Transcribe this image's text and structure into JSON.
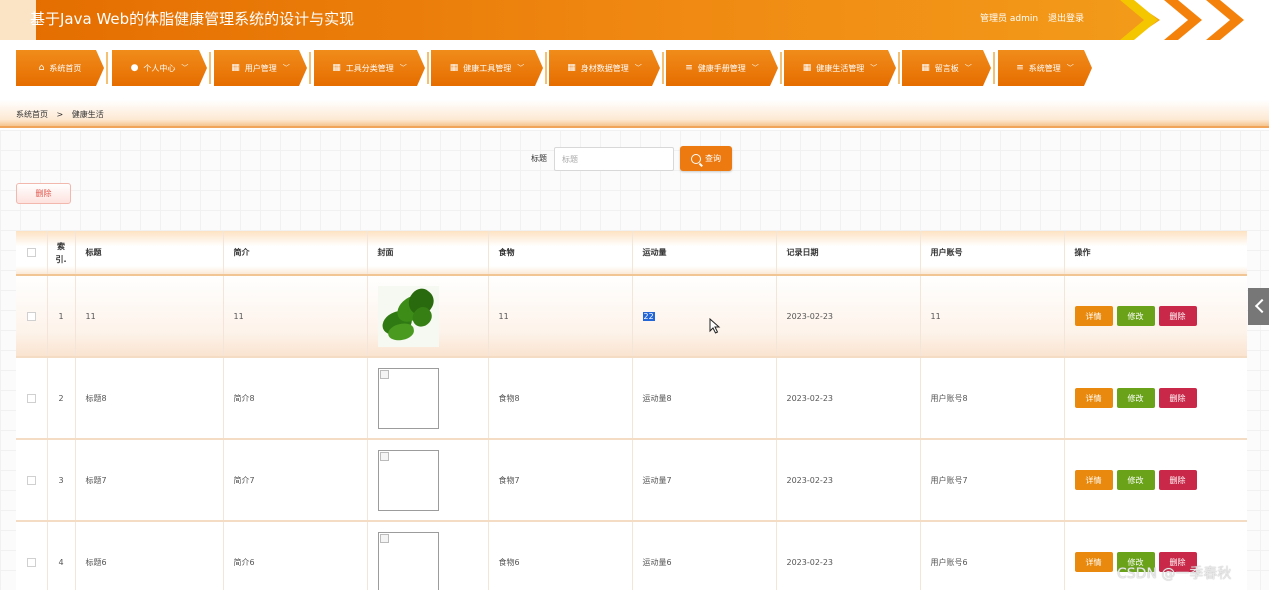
{
  "header": {
    "title": "基于Java Web的体脂健康管理系统的设计与实现",
    "user_label": "管理员 admin",
    "logout_label": "退出登录"
  },
  "nav": {
    "items": [
      {
        "label": "系统首页",
        "icon": "home-icon",
        "has_dropdown": false
      },
      {
        "label": "个人中心",
        "icon": "user-icon",
        "has_dropdown": true
      },
      {
        "label": "用户管理",
        "icon": "grid-icon",
        "has_dropdown": true
      },
      {
        "label": "工具分类管理",
        "icon": "grid-icon",
        "has_dropdown": true
      },
      {
        "label": "健康工具管理",
        "icon": "grid-icon",
        "has_dropdown": true
      },
      {
        "label": "身材数据管理",
        "icon": "grid-icon",
        "has_dropdown": true
      },
      {
        "label": "健康手册管理",
        "icon": "list-icon",
        "has_dropdown": true
      },
      {
        "label": "健康生活管理",
        "icon": "grid-icon",
        "has_dropdown": true
      },
      {
        "label": "留言板",
        "icon": "grid-icon",
        "has_dropdown": true
      },
      {
        "label": "系统管理",
        "icon": "list-icon",
        "has_dropdown": true
      }
    ]
  },
  "breadcrumb": {
    "home": "系统首页",
    "separator": ">",
    "current": "健康生活"
  },
  "search": {
    "label": "标题",
    "placeholder": "标题",
    "button_label": "查询"
  },
  "bulk_delete_label": "删除",
  "table": {
    "headers": {
      "index_line1": "索",
      "index_line2": "引.",
      "title": "标题",
      "intro": "简介",
      "cover": "封面",
      "food": "食物",
      "exercise": "运动量",
      "date": "记录日期",
      "account": "用户账号",
      "actions": "操作"
    },
    "rows": [
      {
        "index": "1",
        "title": "11",
        "intro": "11",
        "cover": "photo",
        "food": "11",
        "exercise": "22",
        "date": "2023-02-23",
        "account": "11"
      },
      {
        "index": "2",
        "title": "标题8",
        "intro": "简介8",
        "cover": "broken",
        "food": "食物8",
        "exercise": "运动量8",
        "date": "2023-02-23",
        "account": "用户账号8"
      },
      {
        "index": "3",
        "title": "标题7",
        "intro": "简介7",
        "cover": "broken",
        "food": "食物7",
        "exercise": "运动量7",
        "date": "2023-02-23",
        "account": "用户账号7"
      },
      {
        "index": "4",
        "title": "标题6",
        "intro": "简介6",
        "cover": "broken",
        "food": "食物6",
        "exercise": "运动量6",
        "date": "2023-02-23",
        "account": "用户账号6"
      }
    ],
    "action_labels": {
      "detail": "详情",
      "edit": "修改",
      "delete": "删除"
    }
  },
  "watermark": "CSDN @一季春秋",
  "colors": {
    "brand_orange": "#ec7a10",
    "edit_green": "#6aa31a",
    "delete_red": "#c92849",
    "selection_blue": "#2266d8"
  }
}
